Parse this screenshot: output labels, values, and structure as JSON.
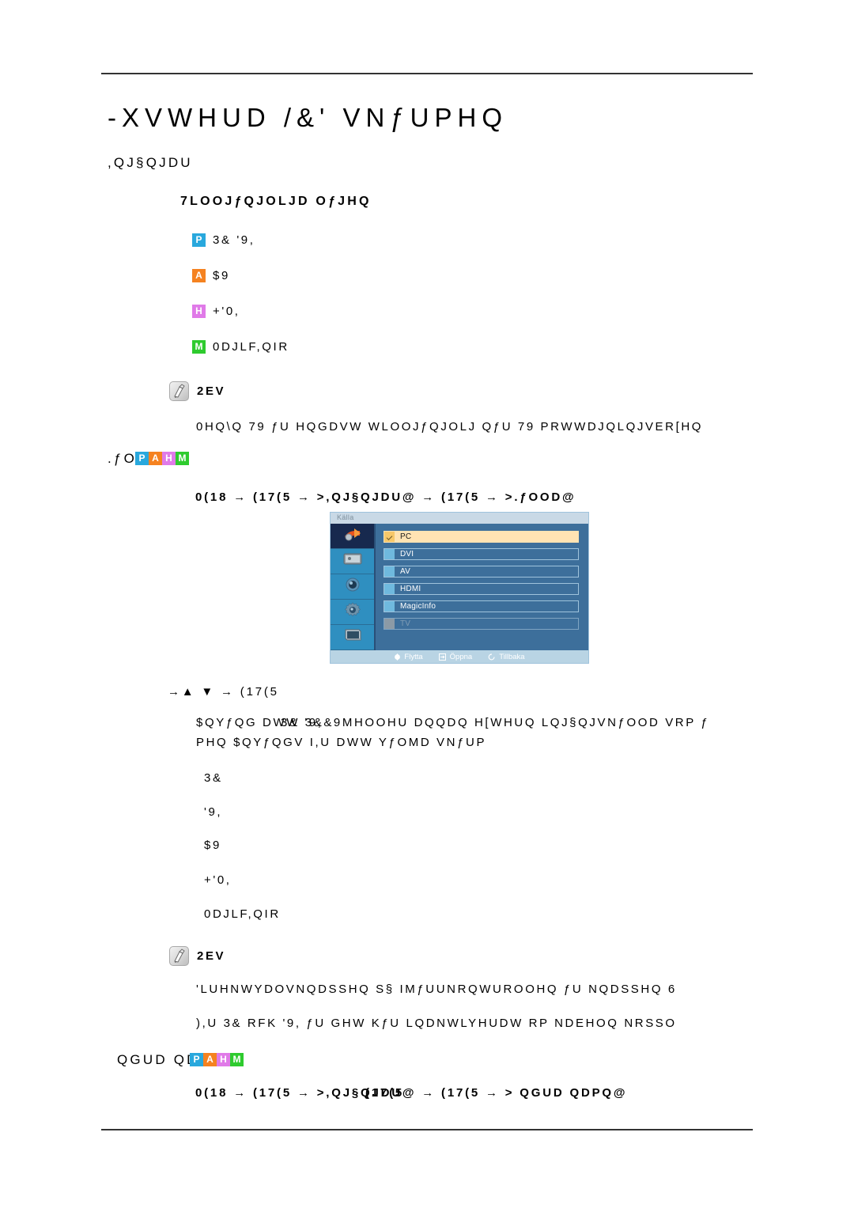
{
  "document": {
    "title": "-XVWHUD /&' VNƒUPHQ",
    "section_heading": ",QJ§QJDU",
    "subsection_heading": "7LOOJƒQJOLJD OƒJHQ"
  },
  "available_modes": [
    {
      "badge": "P",
      "badge_color": "#29a8dd",
      "label": "3&    '9,"
    },
    {
      "badge": "A",
      "badge_color": "#f58220",
      "label": "$9"
    },
    {
      "badge": "H",
      "badge_color": "#e07ae8",
      "label": "+'0,"
    },
    {
      "badge": "M",
      "badge_color": "#2ecb2e",
      "label": "0DJLF,QIR"
    }
  ],
  "note_top": {
    "icon": "note-icon",
    "label": "2EV",
    "text": "0HQ\\Q 79 ƒU HQGDVW WLOOJƒQJOLJ QƒU 79 PRWWDJQLQJVER[HQ"
  },
  "kalla_section": {
    "heading_text": ".ƒOOD",
    "heading_badges": [
      "P",
      "A",
      "H",
      "M"
    ],
    "menu_path": "0(18 →  (17(5 →  >,QJ§QJDU@ →  (17(5 →  >.ƒOOD@",
    "nav_path": "→▲  ▼ →  (17(5",
    "description_line1": "$QYƒQG DWW 3&&9MHOOHU DQQDQ H[WHUQ LQJ§QJVNƒOOD VRP ƒ",
    "description_line1_overlay": "3&  '9,",
    "description_line2": "PHQ  $QYƒQGV I,U DWW YƒOMD VNƒUP",
    "sources": [
      "3&",
      "'9,",
      "$9",
      "+'0,",
      "0DJLF,QIR"
    ]
  },
  "osd": {
    "title": "Källa",
    "sidebar_icons": [
      "input-source-icon",
      "picture-icon",
      "sound-icon",
      "setup-icon",
      "multi-control-icon"
    ],
    "rows": [
      {
        "label": "PC",
        "state": "selected"
      },
      {
        "label": "DVI",
        "state": "normal"
      },
      {
        "label": "AV",
        "state": "normal"
      },
      {
        "label": "HDMI",
        "state": "normal"
      },
      {
        "label": "MagicInfo",
        "state": "normal"
      },
      {
        "label": "TV",
        "state": "disabled"
      }
    ],
    "footer": [
      {
        "icon": "move-icon",
        "label": "Flytta"
      },
      {
        "icon": "enter-icon",
        "label": "Öppna"
      },
      {
        "icon": "return-icon",
        "label": "Tillbaka"
      }
    ]
  },
  "note_bottom": {
    "icon": "note-icon",
    "label": "2EV",
    "line1": "'LUHNWYDOVNQDSSHQ S§ IMƒUUNRQWUROOHQ ƒU NQDSSHQ  6",
    "line2": "),U 3& RFK '9, ƒU GHW KƒU LQDNWLYHUDW RP NDEHOQ NRSSO"
  },
  "andra_namn_section": {
    "heading_text": "QGUD QDPQ",
    "heading_badges": [
      "P",
      "A",
      "H",
      "M"
    ],
    "menu_path": "0(18 →  (17(5 →  >,QJ§QJDU@ → (17(5 →  > QGUD QDPQ@",
    "menu_path_overlay": "(17(5"
  }
}
